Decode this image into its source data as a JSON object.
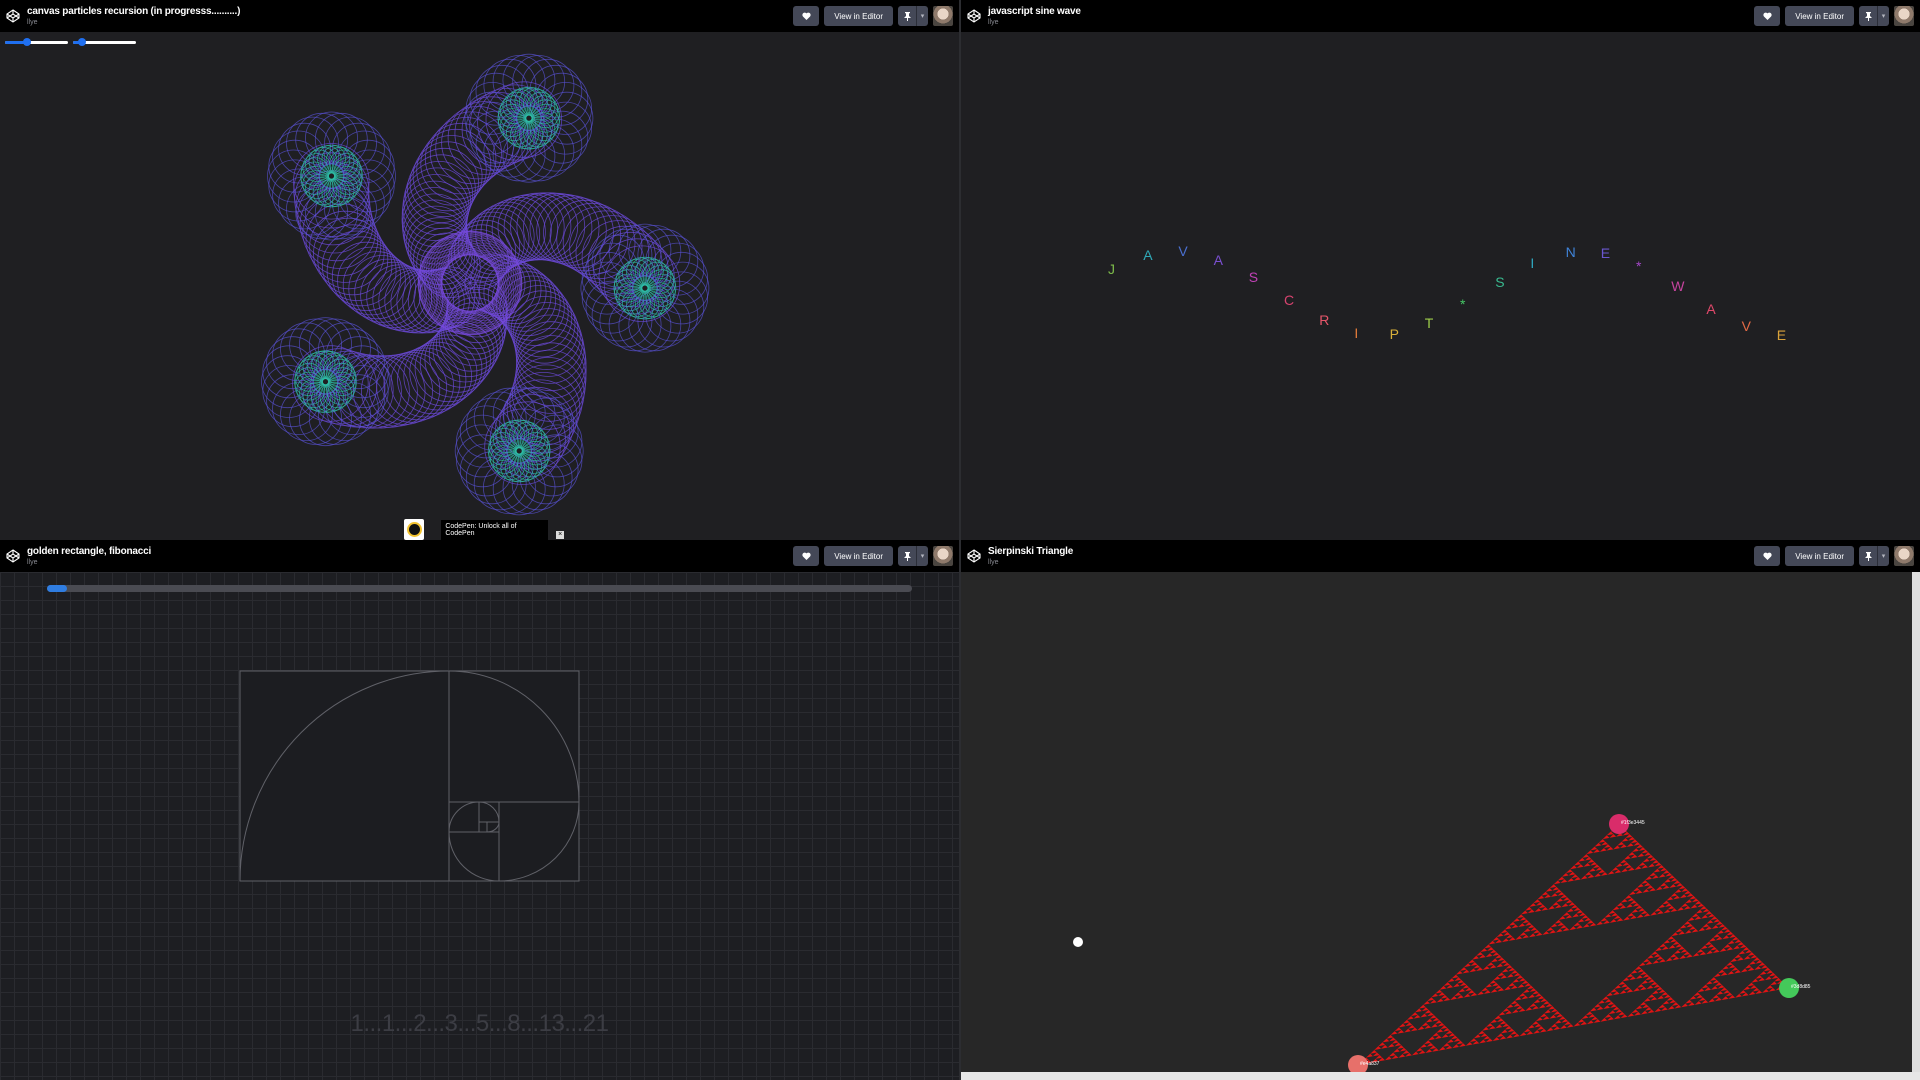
{
  "panes": [
    {
      "title": "canvas particles recursion (in progresss..........)",
      "author": "llye",
      "view_label": "View in Editor",
      "sliders": [
        0.35,
        0.15
      ]
    },
    {
      "title": "javascript sine wave",
      "author": "llye",
      "view_label": "View in Editor",
      "letters": [
        {
          "ch": "J",
          "color": "#7cba4a"
        },
        {
          "ch": "A",
          "color": "#2fa9b8"
        },
        {
          "ch": "V",
          "color": "#4a6fd0"
        },
        {
          "ch": "A",
          "color": "#7a4fd0"
        },
        {
          "ch": "S",
          "color": "#c041b6"
        },
        {
          "ch": "C",
          "color": "#d6436f"
        },
        {
          "ch": "R",
          "color": "#e5566a"
        },
        {
          "ch": "I",
          "color": "#e07a3a"
        },
        {
          "ch": "P",
          "color": "#d9b03a"
        },
        {
          "ch": "T",
          "color": "#9ccc4a"
        },
        {
          "ch": "*",
          "color": "#45c765"
        },
        {
          "ch": "S",
          "color": "#38b98f"
        },
        {
          "ch": "I",
          "color": "#2fa7c0"
        },
        {
          "ch": "N",
          "color": "#3f83d8"
        },
        {
          "ch": "E",
          "color": "#6a57cf"
        },
        {
          "ch": "*",
          "color": "#a447c8"
        },
        {
          "ch": "W",
          "color": "#c6439f"
        },
        {
          "ch": "A",
          "color": "#e0486a"
        },
        {
          "ch": "V",
          "color": "#e46a45"
        },
        {
          "ch": "E",
          "color": "#d9a23a"
        }
      ]
    },
    {
      "title": "golden rectangle, fibonacci",
      "author": "llye",
      "view_label": "View in Editor",
      "progress": 0.02,
      "sequence": "1...1...2...3...5...8...13...21"
    },
    {
      "title": "Sierpinski Triangle",
      "author": "llye",
      "view_label": "View in Editor",
      "vertex_labels": [
        "#1f3e3445",
        "#3d8d85",
        "#e4a837"
      ],
      "vertex_colors": [
        "#d92c6a",
        "#44c95a",
        "#e7706a"
      ]
    }
  ],
  "ad": {
    "text": "CodePen: Unlock all of CodePen"
  }
}
